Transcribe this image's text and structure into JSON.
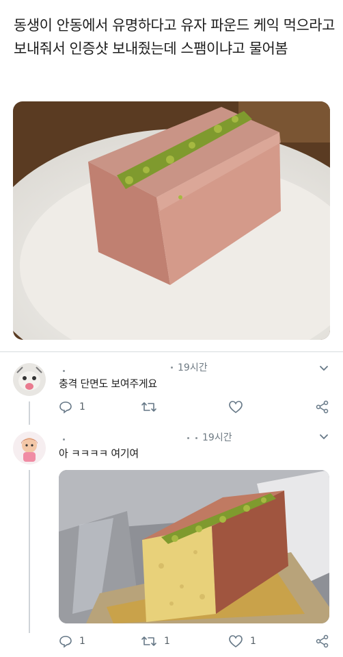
{
  "post": {
    "text": "동생이 안동에서 유명하다고 유자 파운드 케익 먹으라고 보내줘서 인증샷 보내줬는데 스팸이냐고 물어봄"
  },
  "replies": [
    {
      "time": "19시간",
      "text": "충격 단면도 보여주게요",
      "reply_count": "1",
      "retweet_count": "",
      "like_count": ""
    },
    {
      "time": "19시간",
      "text": "아 ㅋㅋㅋㅋ 여기여",
      "reply_count": "1",
      "retweet_count": "1",
      "like_count": "1"
    }
  ],
  "icons": {
    "reply": "reply-icon",
    "retweet": "retweet-icon",
    "like": "heart-icon",
    "share": "share-icon",
    "menu": "chevron-down-icon"
  },
  "colors": {
    "icon": "#657786",
    "divider": "#d7dbde"
  }
}
